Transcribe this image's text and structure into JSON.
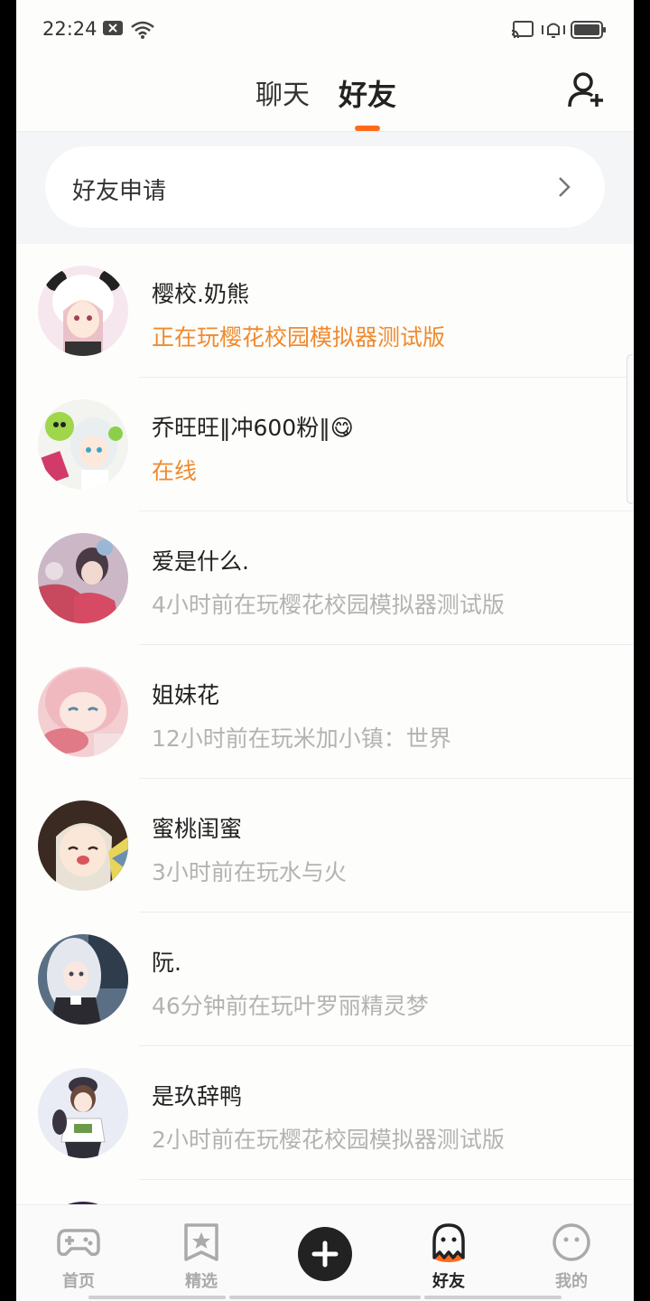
{
  "status_bar": {
    "time": "22:24"
  },
  "header": {
    "tabs": [
      {
        "label": "聊天",
        "active": false
      },
      {
        "label": "好友",
        "active": true
      }
    ],
    "add_friend_icon": "add-user-icon",
    "accent_color": "#ff6a1a"
  },
  "friend_request": {
    "label": "好友申请"
  },
  "friends": [
    {
      "name": "樱校.奶熊",
      "status": "正在玩樱花校园模拟器测试版",
      "active": true
    },
    {
      "name": "乔旺旺‖冲600粉‖😋",
      "status": "在线",
      "active": true
    },
    {
      "name": "爱是什么.",
      "status": "4小时前在玩樱花校园模拟器测试版",
      "active": false
    },
    {
      "name": "姐妹花",
      "status": "12小时前在玩米加小镇：世界",
      "active": false
    },
    {
      "name": "蜜桃闺蜜",
      "status": "3小时前在玩水与火",
      "active": false
    },
    {
      "name": "阮.",
      "status": "46分钟前在玩叶罗丽精灵梦",
      "active": false
    },
    {
      "name": "是玖辞鸭",
      "status": "2小时前在玩樱花校园模拟器测试版",
      "active": false
    }
  ],
  "bottom_nav": [
    {
      "label": "首页",
      "icon": "gamepad-icon",
      "active": false
    },
    {
      "label": "精选",
      "icon": "star-bookmark-icon",
      "active": false
    },
    {
      "label": "",
      "icon": "plus-icon",
      "active": false
    },
    {
      "label": "好友",
      "icon": "ghost-icon",
      "active": true
    },
    {
      "label": "我的",
      "icon": "smiley-icon",
      "active": false
    }
  ]
}
